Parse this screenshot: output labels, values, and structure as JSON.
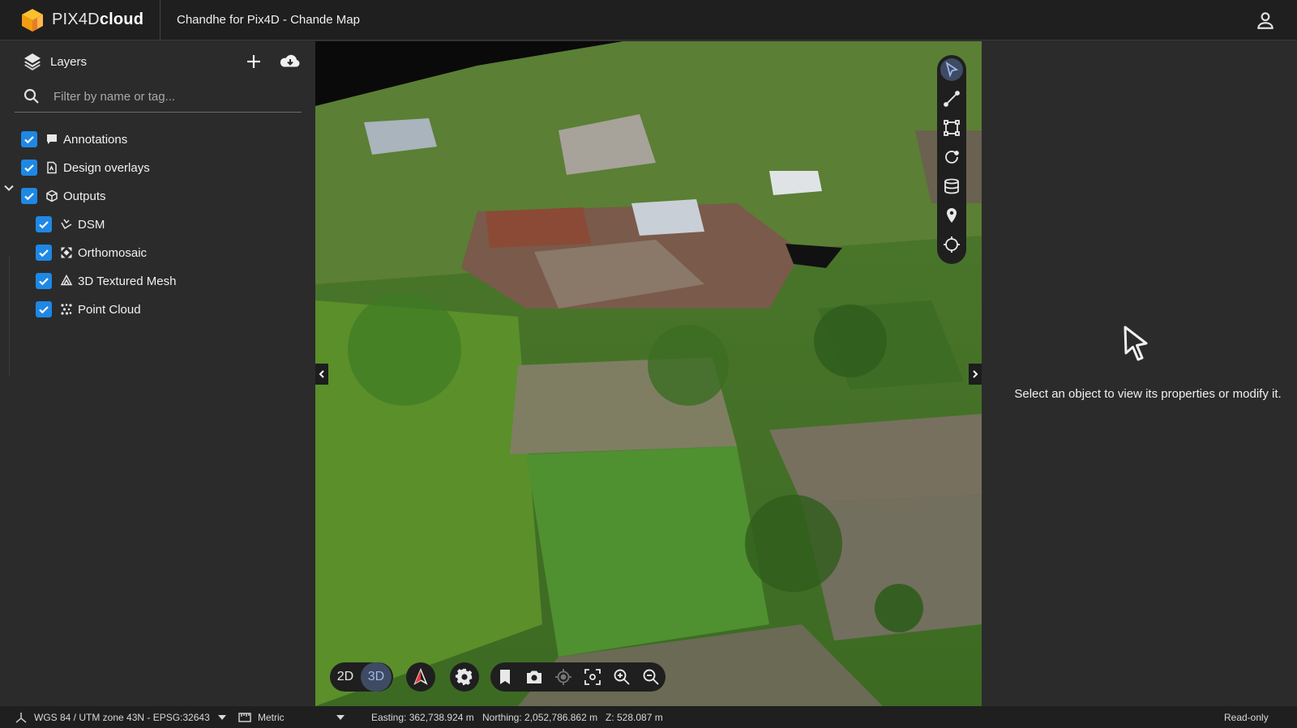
{
  "header": {
    "logo_text_light": "PIX4D",
    "logo_text_bold": "cloud",
    "project_title": "Chandhe for Pix4D - Chande Map",
    "user_icon": "user-icon"
  },
  "sidebar": {
    "title": "Layers",
    "search_placeholder": "Filter by name or tag...",
    "items": [
      {
        "label": "Annotations",
        "icon": "comment-icon",
        "checked": true
      },
      {
        "label": "Design overlays",
        "icon": "document-icon",
        "checked": true
      },
      {
        "label": "Outputs",
        "icon": "cube-icon",
        "checked": true,
        "expanded": true
      },
      {
        "label": "DSM",
        "icon": "dsm-icon",
        "checked": true
      },
      {
        "label": "Orthomosaic",
        "icon": "orthomosaic-icon",
        "checked": true
      },
      {
        "label": "3D Textured Mesh",
        "icon": "mesh-icon",
        "checked": true
      },
      {
        "label": "Point Cloud",
        "icon": "point-cloud-icon",
        "checked": true
      }
    ]
  },
  "viewer": {
    "mode_2d": "2D",
    "mode_3d": "3D",
    "active_mode": "3D",
    "tools": [
      "select-tool-icon",
      "polyline-tool-icon",
      "polygon-tool-icon",
      "volume-tool-icon",
      "layers-tool-icon",
      "marker-tool-icon",
      "target-tool-icon"
    ]
  },
  "properties": {
    "empty_message": "Select an object to view its properties or modify it."
  },
  "statusbar": {
    "crs": "WGS 84 / UTM zone 43N - EPSG:32643",
    "units": "Metric",
    "easting": "Easting: 362,738.924 m",
    "northing": "Northing: 2,052,786.862 m",
    "z": "Z: 528.087 m",
    "access": "Read-only"
  },
  "colors": {
    "accent": "#1e88e5",
    "active_tool": "#3e4b63",
    "topbar": "#1f1f1f",
    "panel": "#2b2b2b",
    "logo_orange": "#f7a823"
  }
}
